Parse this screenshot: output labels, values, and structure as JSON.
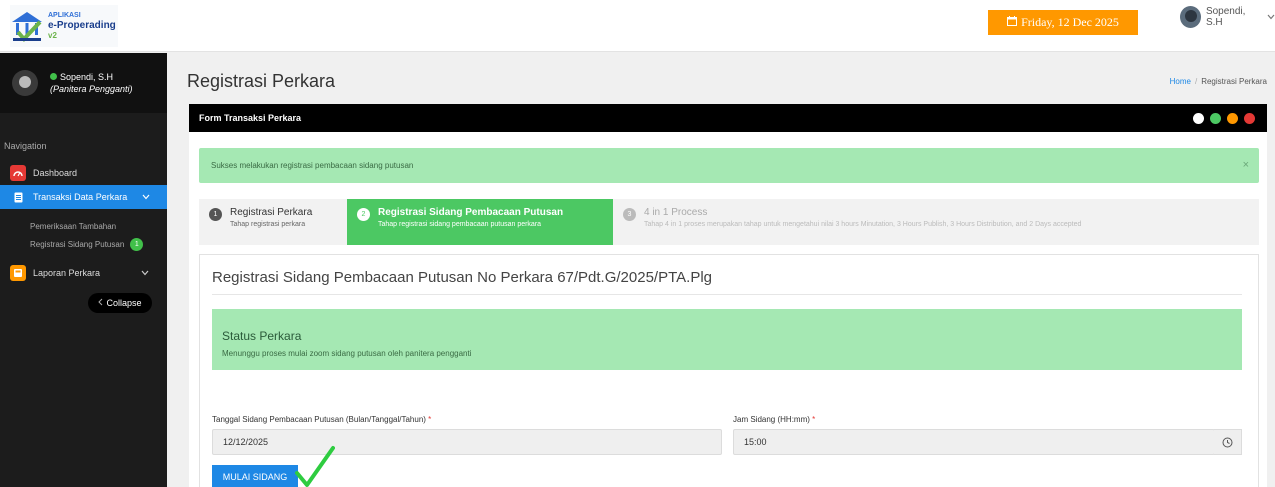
{
  "app": {
    "logo_line1": "APLIKASI",
    "logo_line2": "e-Properading",
    "logo_line3": "v2",
    "date": "Friday, 12 Dec 2025",
    "user_name": "Sopendi, S.H"
  },
  "sidebar": {
    "user_name": "Sopendi, S.H",
    "user_role": "(Panitera Pengganti)",
    "nav_title": "Navigation",
    "items": [
      {
        "label": "Dashboard",
        "icon": "dashboard-icon",
        "color": "#e53935"
      },
      {
        "label": "Transaksi Data Perkara",
        "icon": "document-icon",
        "color": "#1e88e5",
        "active": true
      },
      {
        "label": "Laporan Perkara",
        "icon": "report-icon",
        "color": "#ff9800"
      }
    ],
    "sub_items": [
      {
        "label": "Pemeriksaan Tambahan"
      },
      {
        "label": "Registrasi Sidang Putusan",
        "badge": "1"
      }
    ],
    "collapse_label": "Collapse"
  },
  "page": {
    "title": "Registrasi Perkara",
    "breadcrumb_home": "Home",
    "breadcrumb_current": "Registrasi Perkara"
  },
  "form": {
    "header": "Form Transaksi Perkara",
    "alert": "Sukses melakukan registrasi pembacaan sidang putusan",
    "alert_close": "×",
    "steps": [
      {
        "num": "1",
        "title": "Registrasi Perkara",
        "sub": "Tahap registrasi perkara"
      },
      {
        "num": "2",
        "title": "Registrasi Sidang Pembacaan Putusan",
        "sub": "Tahap registrasi sidang pembacaan putusan perkara"
      },
      {
        "num": "3",
        "title": "4 in 1 Process",
        "sub": "Tahap 4 in 1 proses merupakan tahap untuk mengetahui nilai 3 hours Minutation, 3 Hours Publish, 3 Hours Distribution, and 2 Days accepted"
      }
    ],
    "section_title": "Registrasi Sidang Pembacaan Putusan No Perkara 67/Pdt.G/2025/PTA.Plg",
    "status_title": "Status Perkara",
    "status_text": "Menunggu proses mulai zoom sidang putusan oleh panitera pengganti",
    "date_label": "Tanggal Sidang Pembacaan Putusan (Bulan/Tanggal/Tahun)",
    "date_value": "12/12/2025",
    "time_label": "Jam Sidang (HH:mm)",
    "time_value": "15:00",
    "required_mark": "*",
    "start_button": "MULAI SIDANG"
  },
  "colors": {
    "accent": "#1e88e5",
    "success": "#4cc863",
    "alert_bg": "#a5e8b3",
    "date_badge": "#ff9800"
  }
}
